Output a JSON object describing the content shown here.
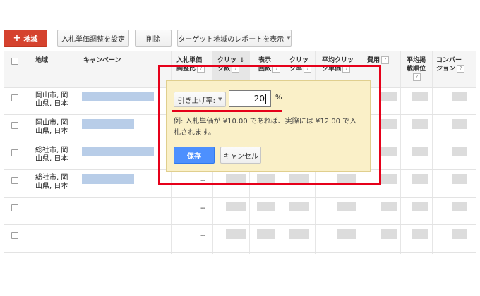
{
  "toolbar": {
    "add_region_label": "地域",
    "bid_adjust_label": "入札単価調整を設定",
    "delete_label": "削除",
    "target_report_label": "ターゲット地域のレポートを表示"
  },
  "table": {
    "headers": {
      "region": "地域",
      "campaign": "キャンペーン",
      "bid_adjust_line1": "入札単価",
      "bid_adjust_line2": "調整比",
      "clicks_line1": "クリッ",
      "clicks_line2": "ク数",
      "impr_line1": "表示",
      "impr_line2": "回数",
      "ctr_line1": "クリッ",
      "ctr_line2": "ク率",
      "cpc_line1": "平均クリッ",
      "cpc_line2": "ク単価",
      "cost": "費用",
      "pos_line1": "平均掲",
      "pos_line2": "載順位",
      "conv_line1": "コンバー",
      "conv_line2": "ジョン"
    },
    "rows": [
      {
        "region_line1": "岡山市, 岡",
        "region_line2": "山県, 日本",
        "bid": ""
      },
      {
        "region_line1": "岡山市, 岡",
        "region_line2": "山県, 日本",
        "bid": ""
      },
      {
        "region_line1": "総社市, 岡",
        "region_line2": "山県, 日本",
        "bid": ""
      },
      {
        "region_line1": "総社市, 岡",
        "region_line2": "山県, 日本",
        "bid": "--"
      },
      {
        "region_line1": "",
        "region_line2": "",
        "bid": "--"
      },
      {
        "region_line1": "",
        "region_line2": "",
        "bid": "--"
      }
    ]
  },
  "popup": {
    "dropdown_label": "引き上げ率:",
    "input_value": "20",
    "percent_sign": "%",
    "example_line1": "例: 入札単価が ¥10.00 であれば、実際には ¥12.00 で入",
    "example_line2": "札されます。",
    "save_label": "保存",
    "cancel_label": "キャンセル"
  },
  "colors": {
    "accent_red": "#d5422e",
    "save_blue": "#4d90fe",
    "popup_bg": "#faf0c8",
    "highlight_frame": "#e6001a"
  }
}
